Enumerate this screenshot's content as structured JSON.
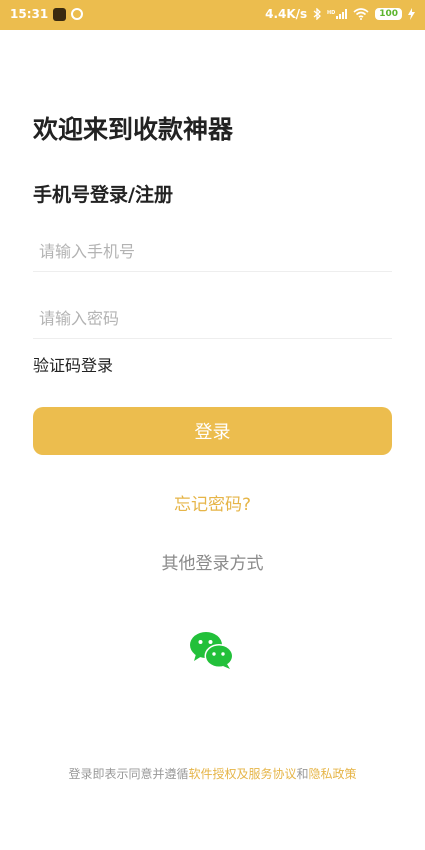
{
  "status_bar": {
    "time": "15:31",
    "network_speed": "4.4K/s",
    "battery": "100",
    "icons": [
      "app-icon",
      "sync-icon",
      "bluetooth-icon",
      "hd-signal-icon",
      "wifi-icon",
      "battery-icon",
      "charging-icon"
    ]
  },
  "welcome_title": "欢迎来到收款神器",
  "subtitle": "手机号登录/注册",
  "phone_input": {
    "value": "",
    "placeholder": "请输入手机号"
  },
  "password_input": {
    "value": "",
    "placeholder": "请输入密码"
  },
  "sms_login_label": "验证码登录",
  "login_button_label": "登录",
  "forgot_password_label": "忘记密码?",
  "other_login_label": "其他登录方式",
  "social_login": {
    "icon": "wechat-icon"
  },
  "agreement": {
    "prefix": "登录即表示同意并遵循",
    "terms_link": "软件授权及服务协议",
    "conjunction": "和",
    "privacy_link": "隐私政策"
  },
  "colors": {
    "accent": "#ecbd4e",
    "link": "#e6b548",
    "wechat": "#22c03a",
    "muted": "#8a8a8a"
  }
}
